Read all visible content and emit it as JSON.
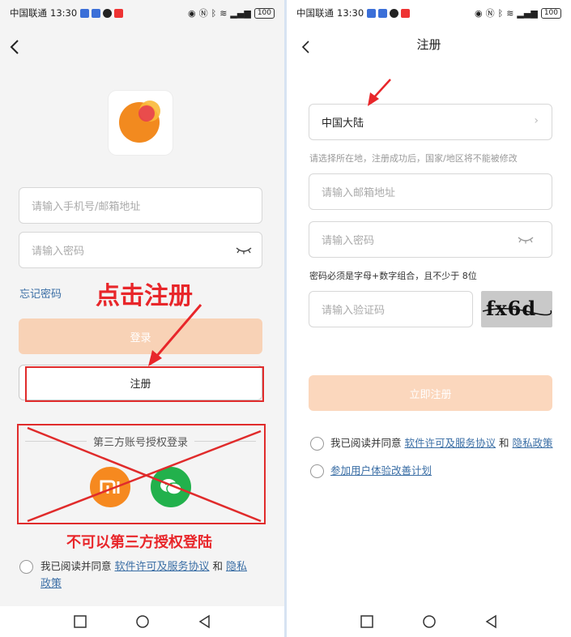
{
  "status": {
    "carrier": "中国联通",
    "time": "13:30",
    "battery": "100"
  },
  "login": {
    "phone_placeholder": "请输入手机号/邮箱地址",
    "password_placeholder": "请输入密码",
    "forgot_password": "忘记密码",
    "login_button": "登录",
    "register_button": "注册",
    "annotation_click": "点击注册",
    "third_party_title": "第三方账号授权登录",
    "annotation_no_third_party": "不可以第三方授权登陆",
    "agree_prefix": "我已阅读并同意",
    "agree_link1": "软件许可及服务协议",
    "agree_and": "和",
    "agree_link2_line1": "隐私",
    "agree_link2_line2": "政策"
  },
  "register": {
    "title": "注册",
    "region_value": "中国大陆",
    "region_hint": "请选择所在地，注册成功后，国家/地区将不能被修改",
    "email_placeholder": "请输入邮箱地址",
    "password_placeholder": "请输入密码",
    "password_hint": "密码必须是字母+数字组合，且不少于 8位",
    "code_placeholder": "请输入验证码",
    "captcha_text": "fx6d",
    "submit_button": "立即注册",
    "agree_prefix": "我已阅读并同意",
    "agree_link1": "软件许可及服务协议",
    "agree_and": "和",
    "agree_link2": "隐私政策",
    "join_program": "参加用户体验改善计划"
  },
  "colors": {
    "accent": "#f28a1f",
    "link": "#3a6ea5",
    "annotation": "#e8262a",
    "mi": "#f6891f",
    "wechat": "#22b14c"
  }
}
